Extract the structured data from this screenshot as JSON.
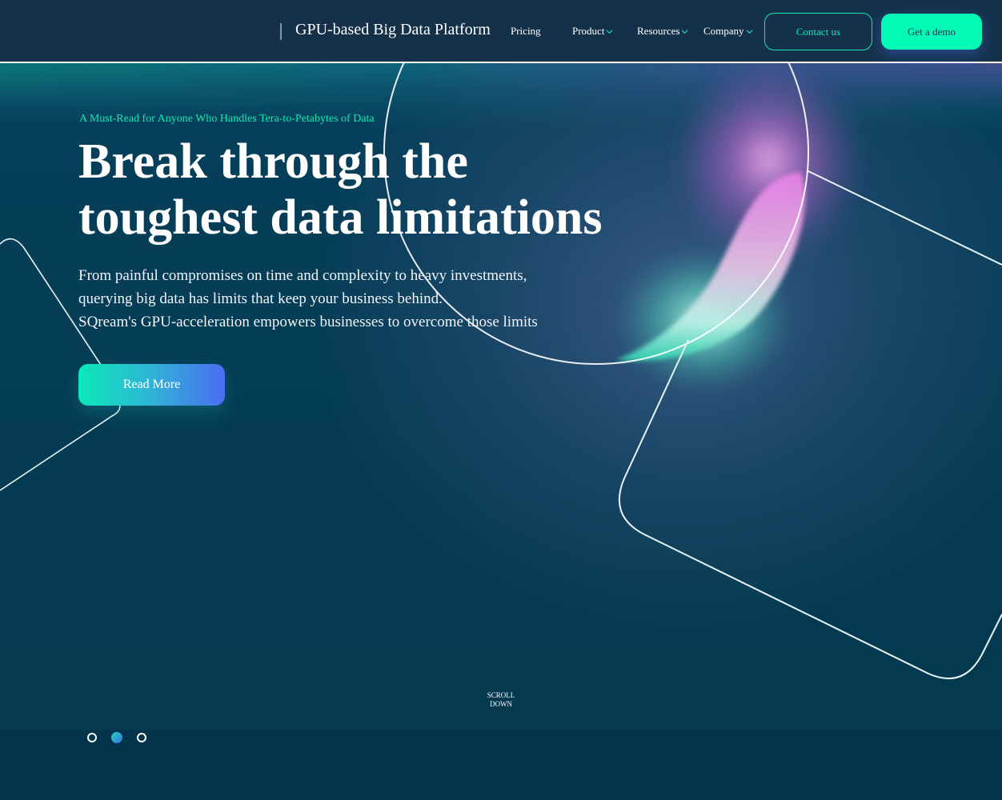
{
  "header": {
    "brand_title": "GPU-based Big Data Platform",
    "nav": [
      {
        "label": "Pricing",
        "has_dropdown": false
      },
      {
        "label": "Product",
        "has_dropdown": true
      },
      {
        "label": "Resources",
        "has_dropdown": true
      },
      {
        "label": "Company",
        "has_dropdown": true
      }
    ],
    "contact_label": "Contact us",
    "demo_label": "Get a demo"
  },
  "hero": {
    "kicker": "A Must-Read for Anyone Who Handles Tera-to-Petabytes of Data",
    "headline_line1": "Break through the",
    "headline_line2": "toughest data limitations",
    "body_lines": [
      "From painful compromises on time and complexity to heavy investments,",
      "querying big data has limits that keep your business behind.",
      "SQream's GPU-acceleration empowers businesses to overcome those limits"
    ],
    "cta_label": "Read More",
    "scroll_line1": "SCROLL",
    "scroll_line2": "DOWN"
  },
  "carousel": {
    "slide_count": 3,
    "active_index": 1
  },
  "colors": {
    "accent_green": "#10e8b0",
    "demo_button": "#03f9b6",
    "header_bg": "#15314a",
    "hero_bg": "#04394f",
    "glow_pink": "#e58ae8"
  }
}
